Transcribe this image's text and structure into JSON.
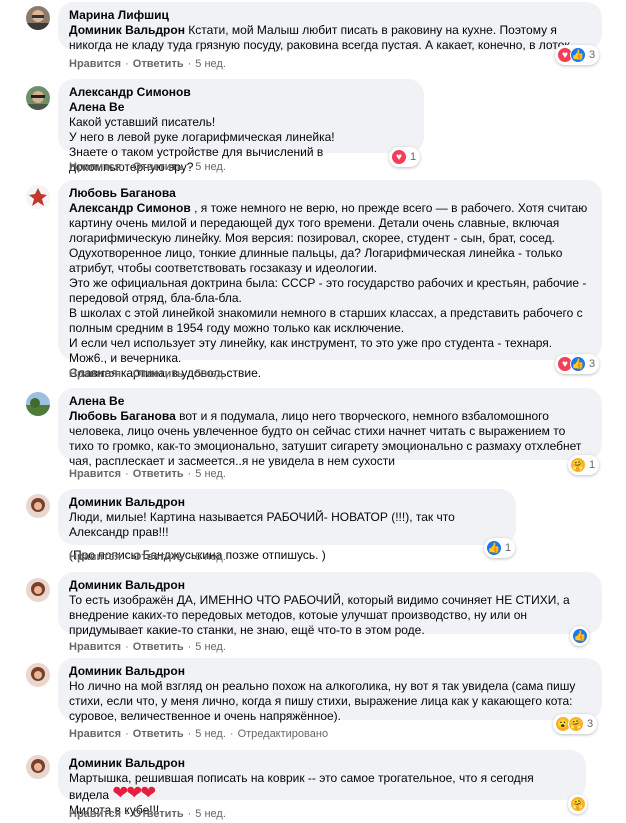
{
  "actions": {
    "like": "Нравится",
    "reply": "Ответить",
    "edited": "Отредактировано"
  },
  "comments": [
    {
      "author": "Марина Лифшиц",
      "mention": "Доминик Вальдрон",
      "text": " Кстати, мой Малыш любит писать в раковину на кухне. Поэтому я никогда не кладу туда грязную посуду, раковина всегда пустая. А какает, конечно, в лоток.",
      "time": "5 нед.",
      "reaction_count": "3",
      "reaction_icons": [
        "heart-icon",
        "like-icon"
      ]
    },
    {
      "author": "Александр Симонов",
      "mention": "Алена Ве",
      "lines": [
        "Какой уставший писатель!",
        "У него в левой руке логарифмическая линейка!",
        "Знаете о таком устройстве для вычислений в докомпьютерную эру?"
      ],
      "time": "5 нед.",
      "reaction_count": "1",
      "reaction_icons": [
        "heart-icon"
      ]
    },
    {
      "author": "Любовь Баганова",
      "mention": "Александр Симонов",
      "text": " , я тоже немного не верю, но прежде всего — в рабочего. Хотя считаю картину очень милой и передающей дух того времени. Детали очень славные, включая логарифмическую линейку. Моя версия: позировал, скорее, студент - сын, брат, сосед. Одухотворенное лицо, тонкие длинные пальцы, да? Логарифмическая линейка - только атрибут, чтобы соответствовать госзаказу и идеологии.",
      "lines": [
        "Это же официальная доктрина была: СССР - это государство рабочих и крестьян, рабочие - передовой отряд, бла-бла-бла.",
        "В школах с этой линейкой знакомили немного в старших классах, а представить рабочего с полным средним в 1954 году можно только как исключение.",
        "И если чел использует эту линейку, как инструмент, то это уже про студента - технаря. Мож6., и вечерника.",
        "Славная картина, в удовольствие."
      ],
      "time": "5 нед.",
      "reaction_count": "3",
      "reaction_icons": [
        "heart-icon",
        "like-icon"
      ]
    },
    {
      "author": "Алена Ве",
      "mention": "Любовь Баганова",
      "text": " вот и я подумала, лицо него творческого, немного взбаломошного человека, лицо очень увлеченное будто он сейчас стихи начнет читать с выражением то тихо то громко, как-то эмоционально, затушит сигарету эмоционально с размаху отхлебнет чая, расплескает и засмеется..я не увидела в нем сухости",
      "time": "5 нед.",
      "reaction_count": "1",
      "reaction_icons": [
        "care-icon"
      ]
    },
    {
      "author": "Доминик Вальдрон",
      "lines": [
        "Люди, милые! Картина называется РАБОЧИЙ- НОВАТОР (!!!), так что Александр прав!!!",
        "",
        "(Про пописы Банджуськина позже отпишусь. )"
      ],
      "time": "5 нед.",
      "reaction_count": "1",
      "reaction_icons": [
        "like-icon"
      ]
    },
    {
      "author": "Доминик Вальдрон",
      "text": "То есть изображён ДА, ИМЕННО ЧТО РАБОЧИЙ, который видимо сочиняет НЕ СТИХИ, а внедрение каких-то передовых методов, котоые улучшат производство, ну или он придумывает какие-то станки, не знаю, ещё что-то в этом роде.",
      "time": "5 нед.",
      "reaction_icons": [
        "like-icon"
      ]
    },
    {
      "author": "Доминик Вальдрон",
      "text": "Но лично на мой взгляд он реально похож на алкоголика, ну вот я так увидела (сама пишу стихи, если что, у меня лично, когда я пишу стихи, выражение лица как у какающего кота: суровое, величественное и очень напряжённое).",
      "time": "5 нед.",
      "reaction_count": "3",
      "reaction_icons": [
        "wow-icon",
        "care-icon"
      ]
    },
    {
      "author": "Доминик Вальдрон",
      "lines": [
        "Мартышка, решившая пописать на коврик -- это самое трогательное, что я сегодня видела",
        "Милота в кубе!!!"
      ],
      "emoji": "❤❤❤",
      "time": "5 нед.",
      "reaction_icons": [
        "care-icon"
      ]
    }
  ]
}
